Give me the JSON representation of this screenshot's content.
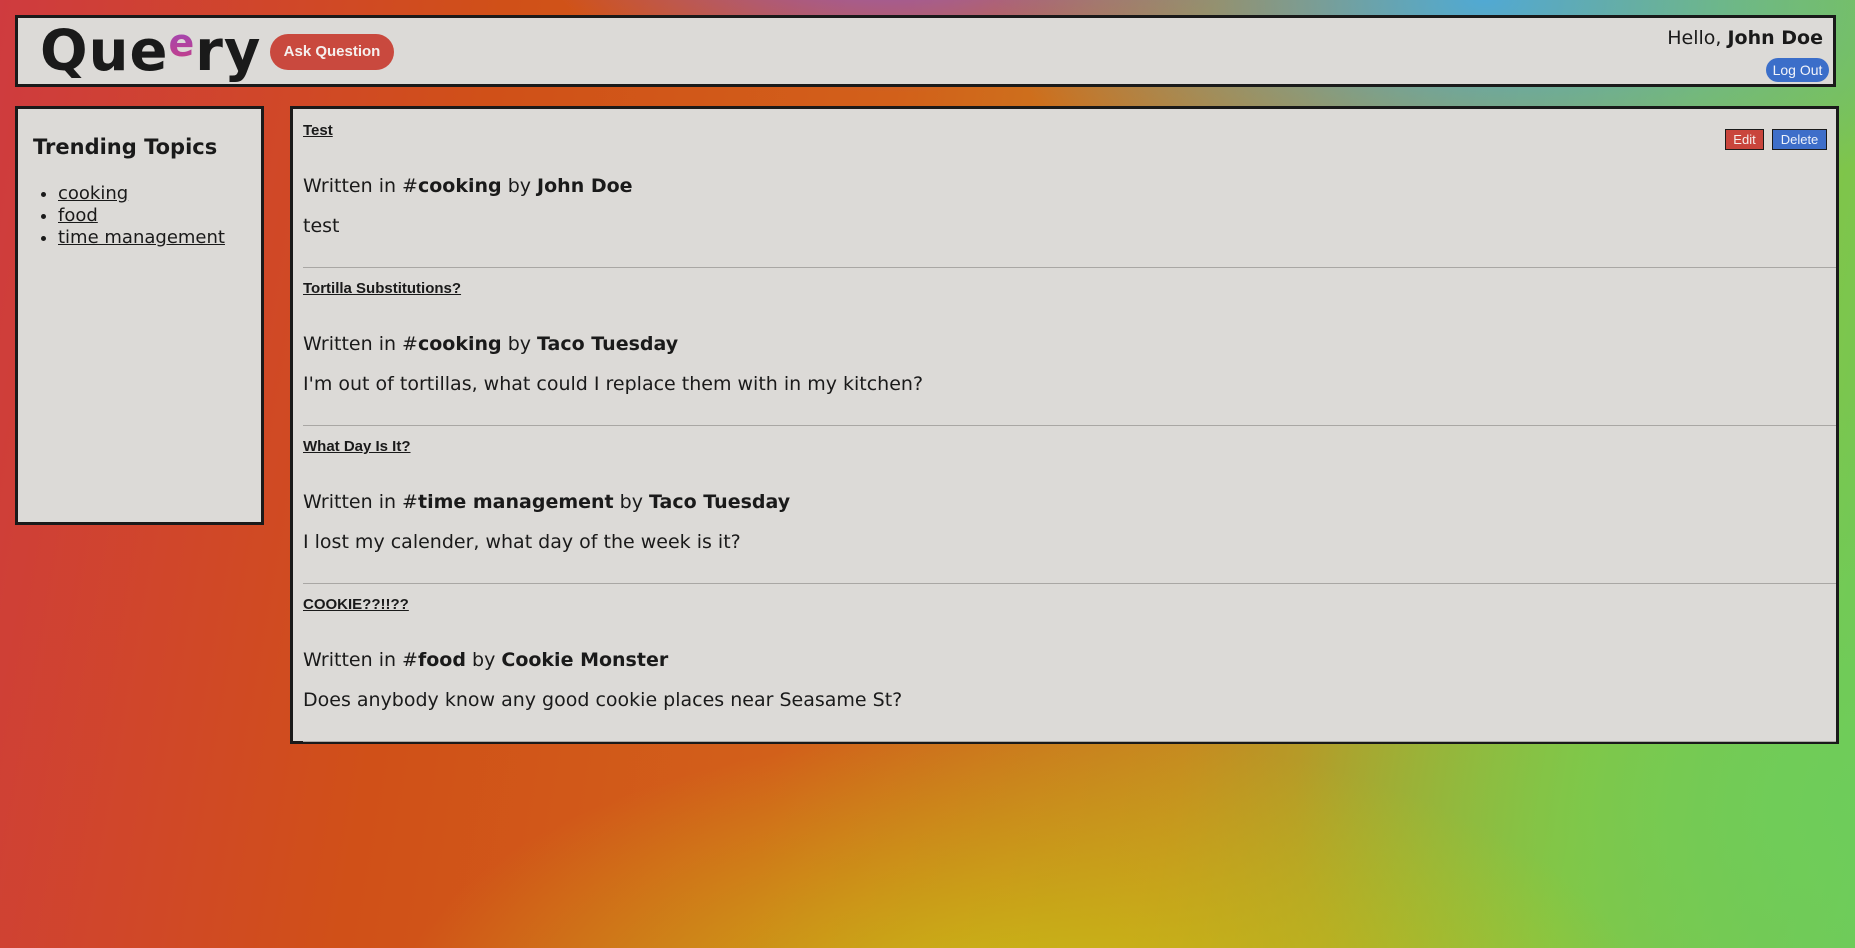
{
  "header": {
    "logo_prefix": "Qu",
    "logo_mid": "e",
    "logo_accent": "e",
    "logo_suffix": "ry",
    "ask_question_label": "Ask Question",
    "greeting": "Hello,",
    "user_name": "John Doe",
    "logout_label": "Log Out"
  },
  "sidebar": {
    "title": "Trending Topics",
    "topics": [
      "cooking",
      "food",
      "time management"
    ]
  },
  "posts": [
    {
      "title": "Test",
      "prefix": "Written in #",
      "topic": "cooking",
      "by": "by",
      "author": "John Doe",
      "body": "test",
      "show_actions": true,
      "edit_label": "Edit",
      "delete_label": "Delete"
    },
    {
      "title": "Tortilla Substitutions?",
      "prefix": "Written in #",
      "topic": "cooking",
      "by": "by",
      "author": "Taco Tuesday",
      "body": "I'm out of tortillas, what could I replace them with in my kitchen?"
    },
    {
      "title": "What Day Is It?",
      "prefix": "Written in #",
      "topic": "time management",
      "by": "by",
      "author": "Taco Tuesday",
      "body": "I lost my calender, what day of the week is it?"
    },
    {
      "title": "COOKIE??!!??",
      "prefix": "Written in #",
      "topic": "food",
      "by": "by",
      "author": "Cookie Monster",
      "body": "Does anybody know any good cookie places near Seasame St?"
    }
  ]
}
